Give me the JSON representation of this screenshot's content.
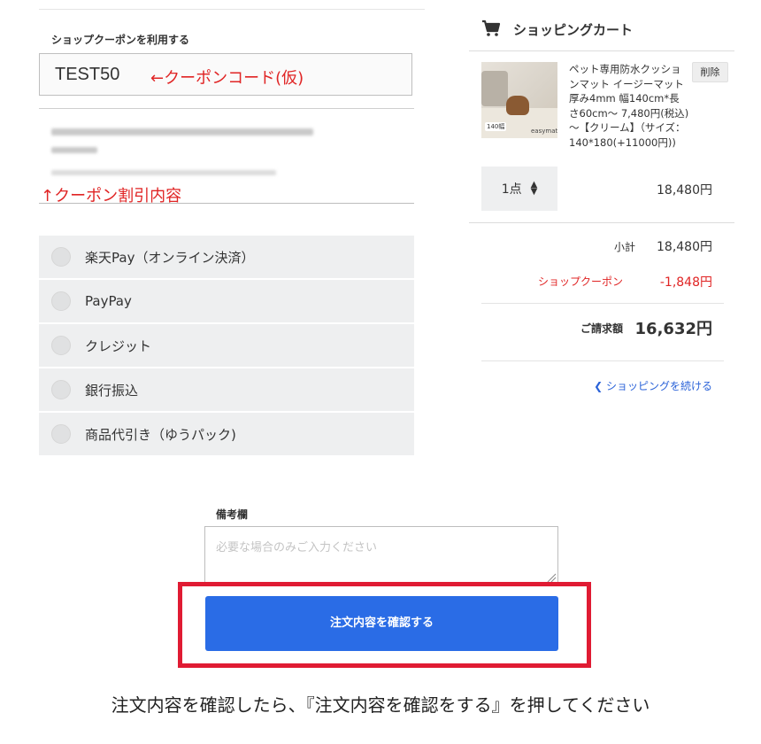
{
  "coupon": {
    "title": "ショップクーポンを利用する",
    "code_value": "TEST50",
    "code_note": "←クーポンコード(仮)",
    "discount_note": "↑クーポン割引内容"
  },
  "payment_methods": [
    {
      "label": "楽天Pay（オンライン決済）"
    },
    {
      "label": "PayPay"
    },
    {
      "label": "クレジット"
    },
    {
      "label": "銀行振込"
    },
    {
      "label": "商品代引き（ゆうパック)"
    }
  ],
  "cart": {
    "title": "ショッピングカート",
    "icon": "shopping-cart-icon",
    "item": {
      "name": "ペット専用防水クッションマット イージーマット 厚み4mm 幅140cm*長さ60cm～ 7,480円(税込)～【クリーム】（サイズ：140*180(+11000円))",
      "delete_label": "削除",
      "quantity": "1点",
      "price": "18,480円",
      "image_tag": "140幅",
      "image_logo": "easymat"
    },
    "subtotal_label": "小計",
    "subtotal_value": "18,480円",
    "coupon_label": "ショップクーポン",
    "coupon_value": "-1,848円",
    "total_label": "ご請求額",
    "total_value": "16,632円",
    "continue_link": "ショッピングを続ける"
  },
  "remarks": {
    "label": "備考欄",
    "placeholder": "必要な場合のみご入力ください"
  },
  "confirm_button": "注文内容を確認する",
  "instruction": "注文内容を確認したら、『注文内容を確認をする』を押してください",
  "colors": {
    "accent_blue": "#2a6ce6",
    "annotation_red": "#e02424",
    "highlight_frame": "#e01b33"
  }
}
